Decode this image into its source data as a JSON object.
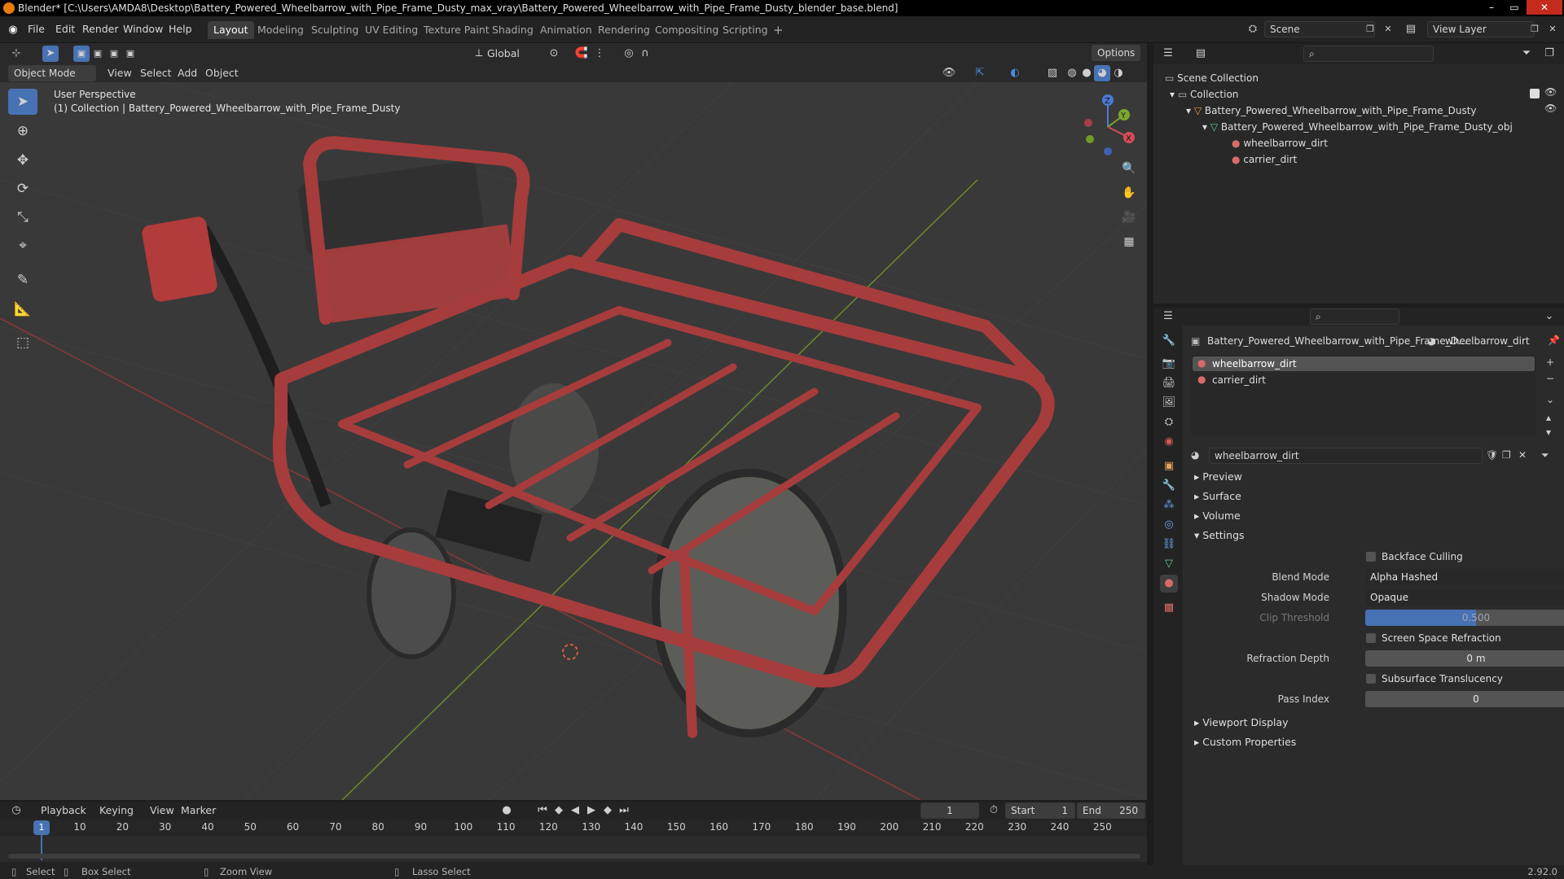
{
  "window": {
    "title": "Blender* [C:\\Users\\AMDA8\\Desktop\\Battery_Powered_Wheelbarrow_with_Pipe_Frame_Dusty_max_vray\\Battery_Powered_Wheelbarrow_with_Pipe_Frame_Dusty_blender_base.blend]",
    "minimize": "–",
    "maximize": "▭",
    "close": "✕"
  },
  "menu": {
    "file": "File",
    "edit": "Edit",
    "render": "Render",
    "window": "Window",
    "help": "Help"
  },
  "workspaces": [
    "Layout",
    "Modeling",
    "Sculpting",
    "UV Editing",
    "Texture Paint",
    "Shading",
    "Animation",
    "Rendering",
    "Compositing",
    "Scripting"
  ],
  "workspace_add": "+",
  "scene": {
    "label": "Scene",
    "view_layer": "View Layer"
  },
  "viewport_header": {
    "mode": "Object Mode",
    "view": "View",
    "select": "Select",
    "add": "Add",
    "object": "Object",
    "transform": "Global",
    "options": "Options"
  },
  "viewport": {
    "perspective": "User Perspective",
    "collection_info": "(1) Collection | Battery_Powered_Wheelbarrow_with_Pipe_Frame_Dusty",
    "gizmo": {
      "x": "X",
      "y": "Y",
      "z": "Z"
    }
  },
  "outliner": {
    "scene_collection": "Scene Collection",
    "collection": "Collection",
    "object": "Battery_Powered_Wheelbarrow_with_Pipe_Frame_Dusty",
    "mesh": "Battery_Powered_Wheelbarrow_with_Pipe_Frame_Dusty_obj",
    "materials": [
      "wheelbarrow_dirt",
      "carrier_dirt"
    ]
  },
  "properties": {
    "object_name": "Battery_Powered_Wheelbarrow_with_Pipe_Frame_D...",
    "active_material": "wheelbarrow_dirt",
    "slots": [
      "wheelbarrow_dirt",
      "carrier_dirt"
    ],
    "material_field": "wheelbarrow_dirt",
    "panels": {
      "preview": "Preview",
      "surface": "Surface",
      "volume": "Volume",
      "settings": "Settings",
      "viewport_display": "Viewport Display",
      "custom_properties": "Custom Properties"
    },
    "settings": {
      "backface_culling": "Backface Culling",
      "blend_mode_label": "Blend Mode",
      "blend_mode": "Alpha Hashed",
      "shadow_mode_label": "Shadow Mode",
      "shadow_mode": "Opaque",
      "clip_threshold_label": "Clip Threshold",
      "clip_threshold": "0.500",
      "screen_space_refraction": "Screen Space Refraction",
      "refraction_depth_label": "Refraction Depth",
      "refraction_depth": "0 m",
      "subsurface_translucency": "Subsurface Translucency",
      "pass_index_label": "Pass Index",
      "pass_index": "0"
    }
  },
  "timeline": {
    "playback": "Playback",
    "keying": "Keying",
    "view": "View",
    "marker": "Marker",
    "current_frame": "1",
    "start_label": "Start",
    "start": "1",
    "end_label": "End",
    "end": "250",
    "playhead": "1",
    "ticks": [
      "10",
      "20",
      "30",
      "40",
      "50",
      "60",
      "70",
      "80",
      "90",
      "100",
      "110",
      "120",
      "130",
      "140",
      "150",
      "160",
      "170",
      "180",
      "190",
      "200",
      "210",
      "220",
      "230",
      "240",
      "250"
    ]
  },
  "statusbar": {
    "select": "Select",
    "box_select": "Box Select",
    "zoom_view": "Zoom View",
    "lasso_select": "Lasso Select",
    "version": "2.92.0"
  },
  "colors": {
    "accent": "#4772b3",
    "background": "#393939",
    "panel": "#2b2b2b",
    "wheelbarrow_red": "#a33a3a"
  }
}
